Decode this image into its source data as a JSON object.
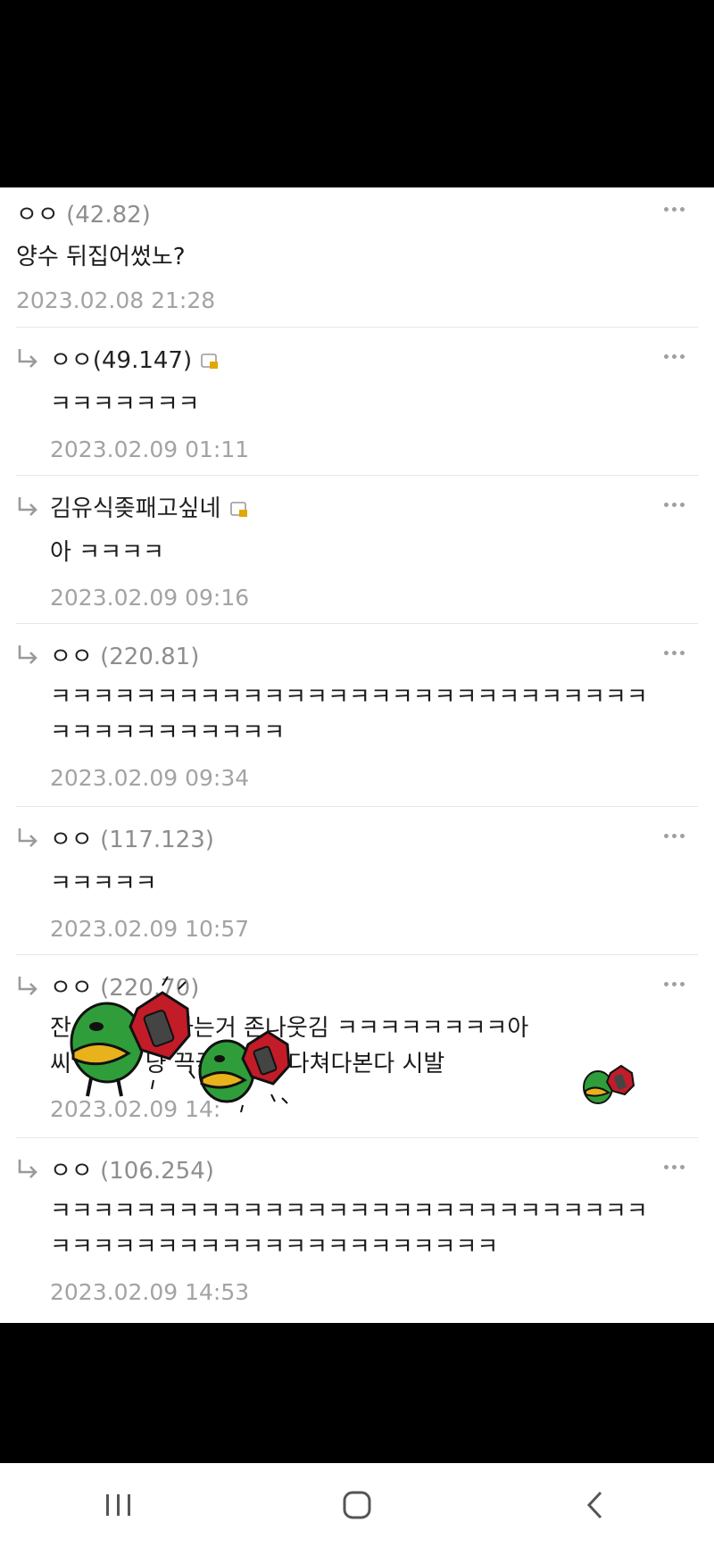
{
  "comments": [
    {
      "name": "ㅇㅇ",
      "ip": "(42.82)",
      "text": "양수 뒤집어썼노?",
      "date": "2023.02.08 21:28",
      "reply": false,
      "locked": false
    },
    {
      "name": "ㅇㅇ(49.147)",
      "ip": "",
      "text": "ㅋㅋㅋㅋㅋㅋㅋ",
      "date": "2023.02.09 01:11",
      "reply": true,
      "locked": true
    },
    {
      "name": "김유식좆패고싶네",
      "ip": "",
      "text": "아 ㅋㅋㅋㅋ",
      "date": "2023.02.09 09:16",
      "reply": true,
      "locked": true
    },
    {
      "name": "ㅇㅇ",
      "ip": "(220.81)",
      "text": "ㅋㅋㅋㅋㅋㅋㅋㅋㅋㅋㅋㅋㅋㅋㅋㅋㅋㅋㅋㅋㅋㅋㅋㅋㅋㅋㅋㅋ\nㅋㅋㅋㅋㅋㅋㅋㅋㅋㅋㅋ",
      "date": "2023.02.09 09:34",
      "reply": true,
      "locked": false
    },
    {
      "name": "ㅇㅇ",
      "ip": "(117.123)",
      "text": "ㅋㅋㅋㅋㅋ",
      "date": "2023.02.09 10:57",
      "reply": true,
      "locked": false
    },
    {
      "name": "ㅇㅇ",
      "ip": "(220.70)",
      "text": "잔    씨들 말하는거 존나웃김 ㅋㅋㅋㅋㅋㅋㅋㅋ아\n씨          냥 끅끅거려서 다쳐다본다 시발",
      "date": "2023.02.09 14:",
      "reply": true,
      "locked": false
    },
    {
      "name": "ㅇㅇ",
      "ip": "(106.254)",
      "text": "ㅋㅋㅋㅋㅋㅋㅋㅋㅋㅋㅋㅋㅋㅋㅋㅋㅋㅋㅋㅋㅋㅋㅋㅋㅋㅋㅋㅋ\nㅋㅋㅋㅋㅋㅋㅋㅋㅋㅋㅋㅋㅋㅋㅋㅋㅋㅋㅋㅋㅋ",
      "date": "2023.02.09 14:53",
      "reply": true,
      "locked": false
    }
  ],
  "icons": {
    "more": "more-icon",
    "reply": "reply-arrow-icon",
    "lock": "lock-icon",
    "sticker": "duck-phone-sticker"
  },
  "navbar": {
    "recent": "recent-apps-icon",
    "home": "home-icon",
    "back": "back-icon"
  }
}
